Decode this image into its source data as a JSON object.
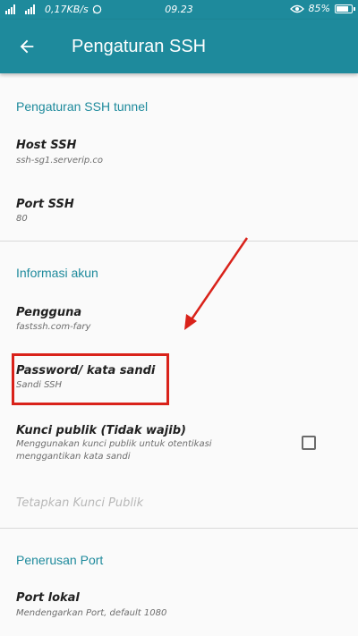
{
  "status_bar": {
    "data_speed": "0,17KB/s",
    "time": "09.23",
    "battery": "85%",
    "battery_level": 0.85
  },
  "toolbar": {
    "title": "Pengaturan SSH"
  },
  "sections": {
    "ssh_tunnel": {
      "header": "Pengaturan SSH tunnel",
      "host": {
        "title": "Host SSH",
        "summary": "ssh-sg1.serverip.co"
      },
      "port": {
        "title": "Port SSH",
        "summary": "80"
      }
    },
    "account": {
      "header": "Informasi akun",
      "user": {
        "title": "Pengguna",
        "summary": "fastssh.com-fary"
      },
      "password": {
        "title": "Password/ kata sandi",
        "summary": "Sandi SSH"
      },
      "public_key": {
        "title": "Kunci publik (Tidak wajib)",
        "summary_line1": "Menggunakan kunci publik untuk otentikasi",
        "summary_line2": "menggantikan kata sandi",
        "checked": false
      },
      "set_public_key": "Tetapkan Kunci Publik"
    },
    "port_forwarding": {
      "header": "Penerusan Port",
      "local_port": {
        "title": "Port lokal",
        "summary": "Mendengarkan Port, default 1080"
      }
    }
  },
  "colors": {
    "accent": "#1e8a9c",
    "annotation": "#d9221a"
  }
}
